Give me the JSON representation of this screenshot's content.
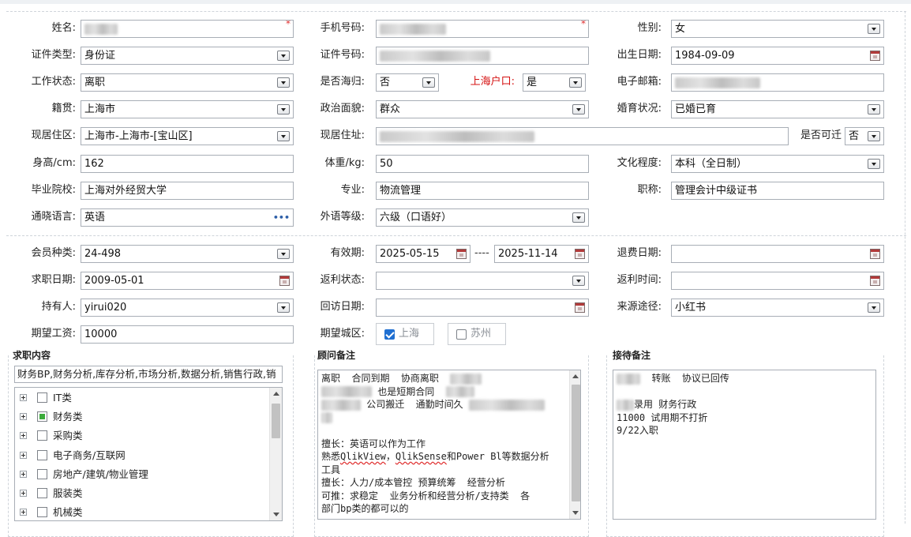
{
  "required_mark": "*",
  "personal": {
    "name_label": "姓名:",
    "phone_label": "手机号码:",
    "gender_label": "性别:",
    "gender": "女",
    "id_type_label": "证件类型:",
    "id_type": "身份证",
    "id_no_label": "证件号码:",
    "birth_label": "出生日期:",
    "birth": "1984-09-09",
    "work_status_label": "工作状态:",
    "work_status": "离职",
    "returnee_label": "是否海归:",
    "returnee": "否",
    "hukou_label": "上海户口:",
    "hukou": "是",
    "email_label": "电子邮箱:",
    "origin_label": "籍贯:",
    "origin": "上海市",
    "political_label": "政治面貌:",
    "political": "群众",
    "marital_label": "婚育状况:",
    "marital": "已婚已育",
    "residence_area_label": "现居住区:",
    "residence_area": "上海市-上海市-[宝山区]",
    "residence_addr_label": "现居住址:",
    "relocate_label": "是否可迁",
    "relocate": "否",
    "height_label": "身高/cm:",
    "height": "162",
    "weight_label": "体重/kg:",
    "weight": "50",
    "education_label": "文化程度:",
    "education": "本科（全日制）",
    "school_label": "毕业院校:",
    "school": "上海对外经贸大学",
    "major_label": "专业:",
    "major": "物流管理",
    "title_label": "职称:",
    "title": "管理会计中级证书",
    "language_label": "通晓语言:",
    "language": "英语",
    "language_more": "•••",
    "fl_level_label": "外语等级:",
    "fl_level": "六级（口语好）"
  },
  "membership": {
    "type_label": "会员种类:",
    "type": "24-498",
    "valid_label": "有效期:",
    "valid_from": "2025-05-15",
    "valid_sep": "----",
    "valid_to": "2025-11-14",
    "refund_label": "退费日期:",
    "job_date_label": "求职日期:",
    "job_date": "2009-05-01",
    "rebate_status_label": "返利状态:",
    "rebate_time_label": "返利时间:",
    "owner_label": "持有人:",
    "owner": "yirui020",
    "revisit_label": "回访日期:",
    "source_label": "来源途径:",
    "source": "小红书",
    "salary_label": "期望工资:",
    "salary": "10000",
    "city_label": "期望城区:",
    "city_options": [
      {
        "label": "上海",
        "checked": true
      },
      {
        "label": "苏州",
        "checked": false
      }
    ]
  },
  "job_content": {
    "title": "求职内容",
    "tags": "财务BP,财务分析,库存分析,市场分析,数据分析,销售行政,销",
    "tree": [
      "IT类",
      "财务类",
      "采购类",
      "电子商务/互联网",
      "房地产/建筑/物业管理",
      "服装类",
      "机械类"
    ]
  },
  "advisor_notes": {
    "title": "顾问备注",
    "line1": "离职  合同到期  协商离职",
    "line2": "也是短期合同",
    "line3": "公司搬迁  通勤时间久",
    "line5": "擅长：英语可以作为工作",
    "line6a": "熟悉",
    "line6b": "QlikView",
    "line6c": "，",
    "line6d": "QlikSense",
    "line6e": "和Power Bl等数据分析",
    "line7": "工具",
    "line8": "擅长：人力/成本管控 预算统筹  经营分析",
    "line9": "可推：求稳定  业务分析和经营分析/支持类  各",
    "line10": "部门bp类的都可以的"
  },
  "reception_notes": {
    "title": "接待备注",
    "line1": "转账  协议已回传",
    "line2": "录用 财务行政",
    "line3": "11000 试用期不打折",
    "line4": "9/22入职"
  }
}
